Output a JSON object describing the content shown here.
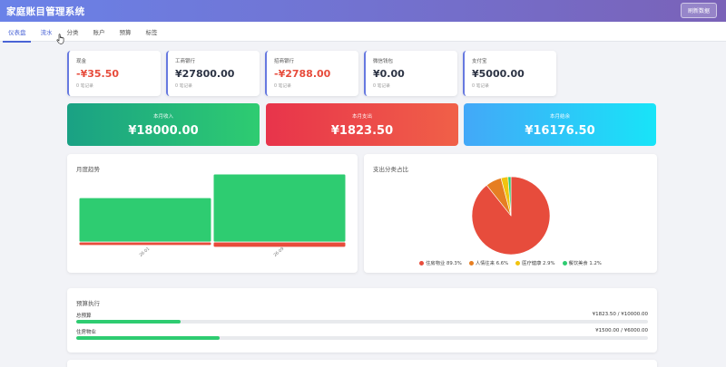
{
  "header": {
    "title": "家庭账目管理系统",
    "refresh_label": "刷新数据"
  },
  "tabs": [
    {
      "label": "仪表盘",
      "active": true
    },
    {
      "label": "流水",
      "hovered": true
    },
    {
      "label": "分类"
    },
    {
      "label": "账户"
    },
    {
      "label": "预算"
    },
    {
      "label": "标签"
    }
  ],
  "accounts": [
    {
      "name": "现金",
      "balance": "-¥35.50",
      "negative": true,
      "count": "0 笔记录"
    },
    {
      "name": "工商银行",
      "balance": "¥27800.00",
      "negative": false,
      "count": "0 笔记录"
    },
    {
      "name": "招商银行",
      "balance": "-¥2788.00",
      "negative": true,
      "count": "0 笔记录"
    },
    {
      "name": "微信钱包",
      "balance": "¥0.00",
      "negative": false,
      "count": "0 笔记录"
    },
    {
      "name": "支付宝",
      "balance": "¥5000.00",
      "negative": false,
      "count": "0 笔记录"
    }
  ],
  "summary": {
    "income": {
      "label": "本月收入",
      "value": "¥18000.00"
    },
    "expense": {
      "label": "本月支出",
      "value": "¥1823.50"
    },
    "balance": {
      "label": "本月结余",
      "value": "¥16176.50"
    }
  },
  "colors": {
    "income": "#2ecc71",
    "expense": "#e74c3c",
    "accent": "#4a64d6"
  },
  "chart_data": [
    {
      "type": "bar",
      "title": "月度趋势",
      "categories": [
        "26-01",
        "26-09"
      ],
      "series": [
        {
          "values": [
            18000,
            27800
          ],
          "color": "#2ecc71"
        },
        {
          "values": [
            -1100,
            -1823.5
          ],
          "color": "#e74c3c"
        }
      ],
      "ylim": [
        -2000,
        28000
      ]
    },
    {
      "type": "pie",
      "title": "支出分类占比",
      "slices": [
        {
          "name": "住房物业",
          "value": 89.3,
          "label": "89.3%",
          "color": "#e74c3c"
        },
        {
          "name": "人情往来",
          "value": 6.6,
          "label": "6.6%",
          "color": "#e67e22"
        },
        {
          "name": "医疗健康",
          "value": 2.9,
          "label": "2.9%",
          "color": "#f1c40f"
        },
        {
          "name": "餐饮美食",
          "value": 1.2,
          "label": "1.2%",
          "color": "#2ecc71"
        }
      ],
      "legend_position": "bottom"
    }
  ],
  "budget": {
    "title": "预算执行",
    "items": [
      {
        "name": "总预算",
        "amount": "¥1823.50 / ¥10000.00",
        "fraction": 0.182
      },
      {
        "name": "住房物业",
        "amount": "¥1500.00 / ¥6000.00",
        "fraction": 0.25
      }
    ]
  }
}
